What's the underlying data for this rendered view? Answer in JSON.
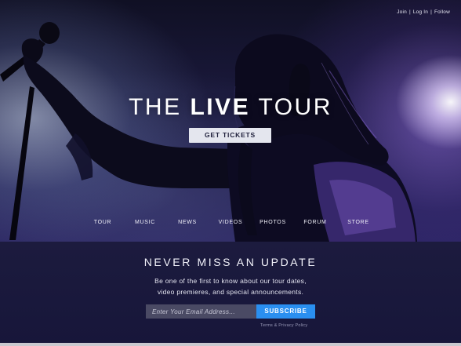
{
  "top_links": {
    "join": "Join",
    "sep1": "|",
    "login": "Log In",
    "sep2": "|",
    "follow": "Follow"
  },
  "hero": {
    "title_pre": "THE",
    "title_bold": "LIVE",
    "title_post": "TOUR",
    "cta_label": "GET TICKETS"
  },
  "nav": {
    "items": [
      {
        "label": "TOUR"
      },
      {
        "label": "MUSIC"
      },
      {
        "label": "NEWS"
      },
      {
        "label": "VIDEOS"
      },
      {
        "label": "PHOTOS"
      },
      {
        "label": "FORUM"
      },
      {
        "label": "STORE"
      }
    ]
  },
  "signup": {
    "title": "NEVER MISS AN UPDATE",
    "desc_line1": "Be one of the first to know about our tour dates,",
    "desc_line2": "video premieres, and special announcements.",
    "email_placeholder": "Enter Your Email Address...",
    "subscribe_label": "SUBSCRIBE",
    "terms_label": "Terms & Privacy Policy"
  },
  "colors": {
    "accent": "#2a8ff0",
    "background": "#1c1b3e",
    "stage_light_purple": "#a078f0",
    "button_light": "#e4e6ee"
  }
}
